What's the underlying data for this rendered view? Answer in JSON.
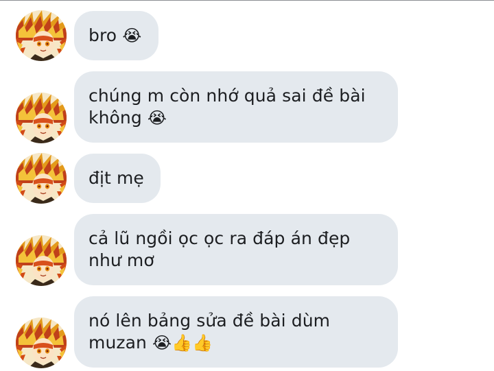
{
  "colors": {
    "bubble_bg": "#e4e9ee",
    "text": "#1c1e21",
    "page_bg": "#ffffff"
  },
  "messages": [
    {
      "text": "bro",
      "emojis": "😭",
      "avatar_icon": "rengoku-avatar-icon"
    },
    {
      "text": "chúng m còn nhớ quả sai đề bài không",
      "emojis": "😭",
      "avatar_icon": "rengoku-avatar-icon"
    },
    {
      "text": "địt mẹ",
      "emojis": "",
      "avatar_icon": "rengoku-avatar-icon"
    },
    {
      "text": "cả lũ ngồi ọc ọc ra đáp án đẹp như mơ",
      "emojis": "",
      "avatar_icon": "rengoku-avatar-icon"
    },
    {
      "text": "nó lên bảng sửa đề bài dùm muzan",
      "emojis": "😭👍👍",
      "avatar_icon": "rengoku-avatar-icon"
    }
  ]
}
